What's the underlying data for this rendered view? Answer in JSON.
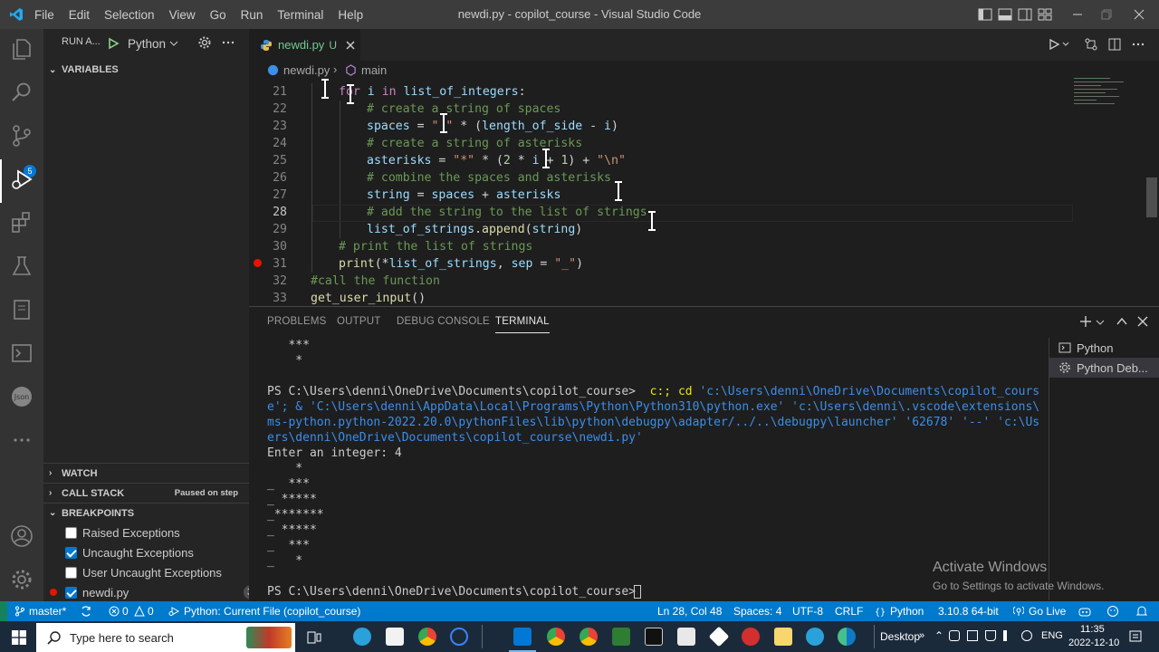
{
  "titlebar": {
    "menu": [
      "File",
      "Edit",
      "Selection",
      "View",
      "Go",
      "Run",
      "Terminal",
      "Help"
    ],
    "title": "newdi.py - copilot_course - Visual Studio Code"
  },
  "activity": {
    "source_control_badge": "5"
  },
  "sidebar": {
    "run_label": "RUN A...",
    "config": "Python",
    "variables": "VARIABLES",
    "watch": "WATCH",
    "call_stack": "CALL STACK",
    "call_stack_status": "Paused on step",
    "breakpoints": "BREAKPOINTS",
    "breakpoint_items": [
      {
        "label": "Raised Exceptions",
        "checked": false
      },
      {
        "label": "Uncaught Exceptions",
        "checked": true
      },
      {
        "label": "User Uncaught Exceptions",
        "checked": false
      },
      {
        "label": "newdi.py",
        "checked": true,
        "count": "31"
      }
    ]
  },
  "editor": {
    "tab_label": "newdi.py",
    "tab_status": "U",
    "breadcrumb_file": "newdi.py",
    "breadcrumb_symbol": "main",
    "lines": [
      {
        "n": "21",
        "indent": 1,
        "tokens": [
          [
            "kw",
            "for"
          ],
          [
            "",
            " "
          ],
          [
            "var",
            "i"
          ],
          [
            "",
            " "
          ],
          [
            "kw",
            "in"
          ],
          [
            "",
            " "
          ],
          [
            "var",
            "list_of_integers"
          ],
          [
            "",
            ":"
          ]
        ]
      },
      {
        "n": "22",
        "indent": 2,
        "tokens": [
          [
            "cmt",
            "# create a string of spaces"
          ]
        ]
      },
      {
        "n": "23",
        "indent": 2,
        "tokens": [
          [
            "var",
            "spaces"
          ],
          [
            "",
            " = "
          ],
          [
            "str",
            "\" \""
          ],
          [
            "",
            " * ("
          ],
          [
            "var",
            "length_of_side"
          ],
          [
            "",
            " - "
          ],
          [
            "var",
            "i"
          ],
          [
            "",
            ")"
          ]
        ]
      },
      {
        "n": "24",
        "indent": 2,
        "tokens": [
          [
            "cmt",
            "# create a string of asterisks"
          ]
        ]
      },
      {
        "n": "25",
        "indent": 2,
        "tokens": [
          [
            "var",
            "asterisks"
          ],
          [
            "",
            " = "
          ],
          [
            "str",
            "\"*\""
          ],
          [
            "",
            " * ("
          ],
          [
            "num",
            "2"
          ],
          [
            "",
            " * "
          ],
          [
            "var",
            "i"
          ],
          [
            "",
            " + "
          ],
          [
            "num",
            "1"
          ],
          [
            "",
            ") + "
          ],
          [
            "str",
            "\"\\n\""
          ]
        ]
      },
      {
        "n": "26",
        "indent": 2,
        "tokens": [
          [
            "cmt",
            "# combine the spaces and asterisks"
          ]
        ]
      },
      {
        "n": "27",
        "indent": 2,
        "tokens": [
          [
            "var",
            "string"
          ],
          [
            "",
            " = "
          ],
          [
            "var",
            "spaces"
          ],
          [
            "",
            " + "
          ],
          [
            "var",
            "asterisks"
          ]
        ]
      },
      {
        "n": "28",
        "indent": 2,
        "tokens": [
          [
            "cmt",
            "# add the string to the list of strings"
          ]
        ]
      },
      {
        "n": "29",
        "indent": 2,
        "tokens": [
          [
            "var",
            "list_of_strings"
          ],
          [
            "",
            "."
          ],
          [
            "fn",
            "append"
          ],
          [
            "",
            "("
          ],
          [
            "var",
            "string"
          ],
          [
            "",
            ")"
          ]
        ]
      },
      {
        "n": "30",
        "indent": 1,
        "tokens": [
          [
            "cmt",
            "# print the list of strings"
          ]
        ]
      },
      {
        "n": "31",
        "indent": 1,
        "tokens": [
          [
            "fn",
            "print"
          ],
          [
            "",
            "(*"
          ],
          [
            "var",
            "list_of_strings"
          ],
          [
            "",
            ", "
          ],
          [
            "var",
            "sep"
          ],
          [
            "",
            " = "
          ],
          [
            "str",
            "\"_\""
          ],
          [
            "",
            ")"
          ]
        ]
      },
      {
        "n": "32",
        "indent": 0,
        "tokens": [
          [
            "cmt",
            "#call the function"
          ]
        ]
      },
      {
        "n": "33",
        "indent": 0,
        "tokens": [
          [
            "fn",
            "get_user_input"
          ],
          [
            "",
            "()"
          ]
        ]
      }
    ]
  },
  "panel": {
    "tabs": [
      "PROBLEMS",
      "OUTPUT",
      "DEBUG CONSOLE",
      "TERMINAL"
    ],
    "terminal_lines": [
      "   ***",
      "    *",
      "",
      "PS C:\\Users\\denni\\OneDrive\\Documents\\copilot_course>  c:; cd 'c:\\Users\\denni\\OneDrive\\Documents\\copilot_cours",
      "e'; & 'C:\\Users\\denni\\AppData\\Local\\Programs\\Python\\Python310\\python.exe' 'c:\\Users\\denni\\.vscode\\extensions\\",
      "ms-python.python-2022.20.0\\pythonFiles\\lib\\python\\debugpy\\adapter/../..\\debugpy\\launcher' '62678' '--' 'c:\\Us",
      "ers\\denni\\OneDrive\\Documents\\copilot_course\\newdi.py'",
      "Enter an integer: 4",
      "    *",
      "_  ***",
      "_ *****",
      "_*******",
      "_ *****",
      "_  ***",
      "_   *",
      "",
      "PS C:\\Users\\denni\\OneDrive\\Documents\\copilot_course> "
    ],
    "terminal_instances": [
      "Python",
      "Python Deb..."
    ]
  },
  "watermark": {
    "title": "Activate Windows",
    "sub": "Go to Settings to activate Windows."
  },
  "statusbar": {
    "branch": "master*",
    "errors": "0",
    "warnings": "0",
    "debug": "Python: Current File (copilot_course)",
    "position": "Ln 28, Col 48",
    "spaces": "Spaces: 4",
    "encoding": "UTF-8",
    "eol": "CRLF",
    "language": "Python",
    "interpreter": "3.10.8 64-bit",
    "golive": "Go Live"
  },
  "taskbar": {
    "search_placeholder": "Type here to search",
    "desktop": "Desktop",
    "lang": "ENG",
    "time": "11:35",
    "date": "2022-12-10"
  },
  "colors": {
    "accent": "#007acc",
    "activity": "#333333",
    "sidebar": "#252526",
    "editor": "#1e1e1e"
  }
}
